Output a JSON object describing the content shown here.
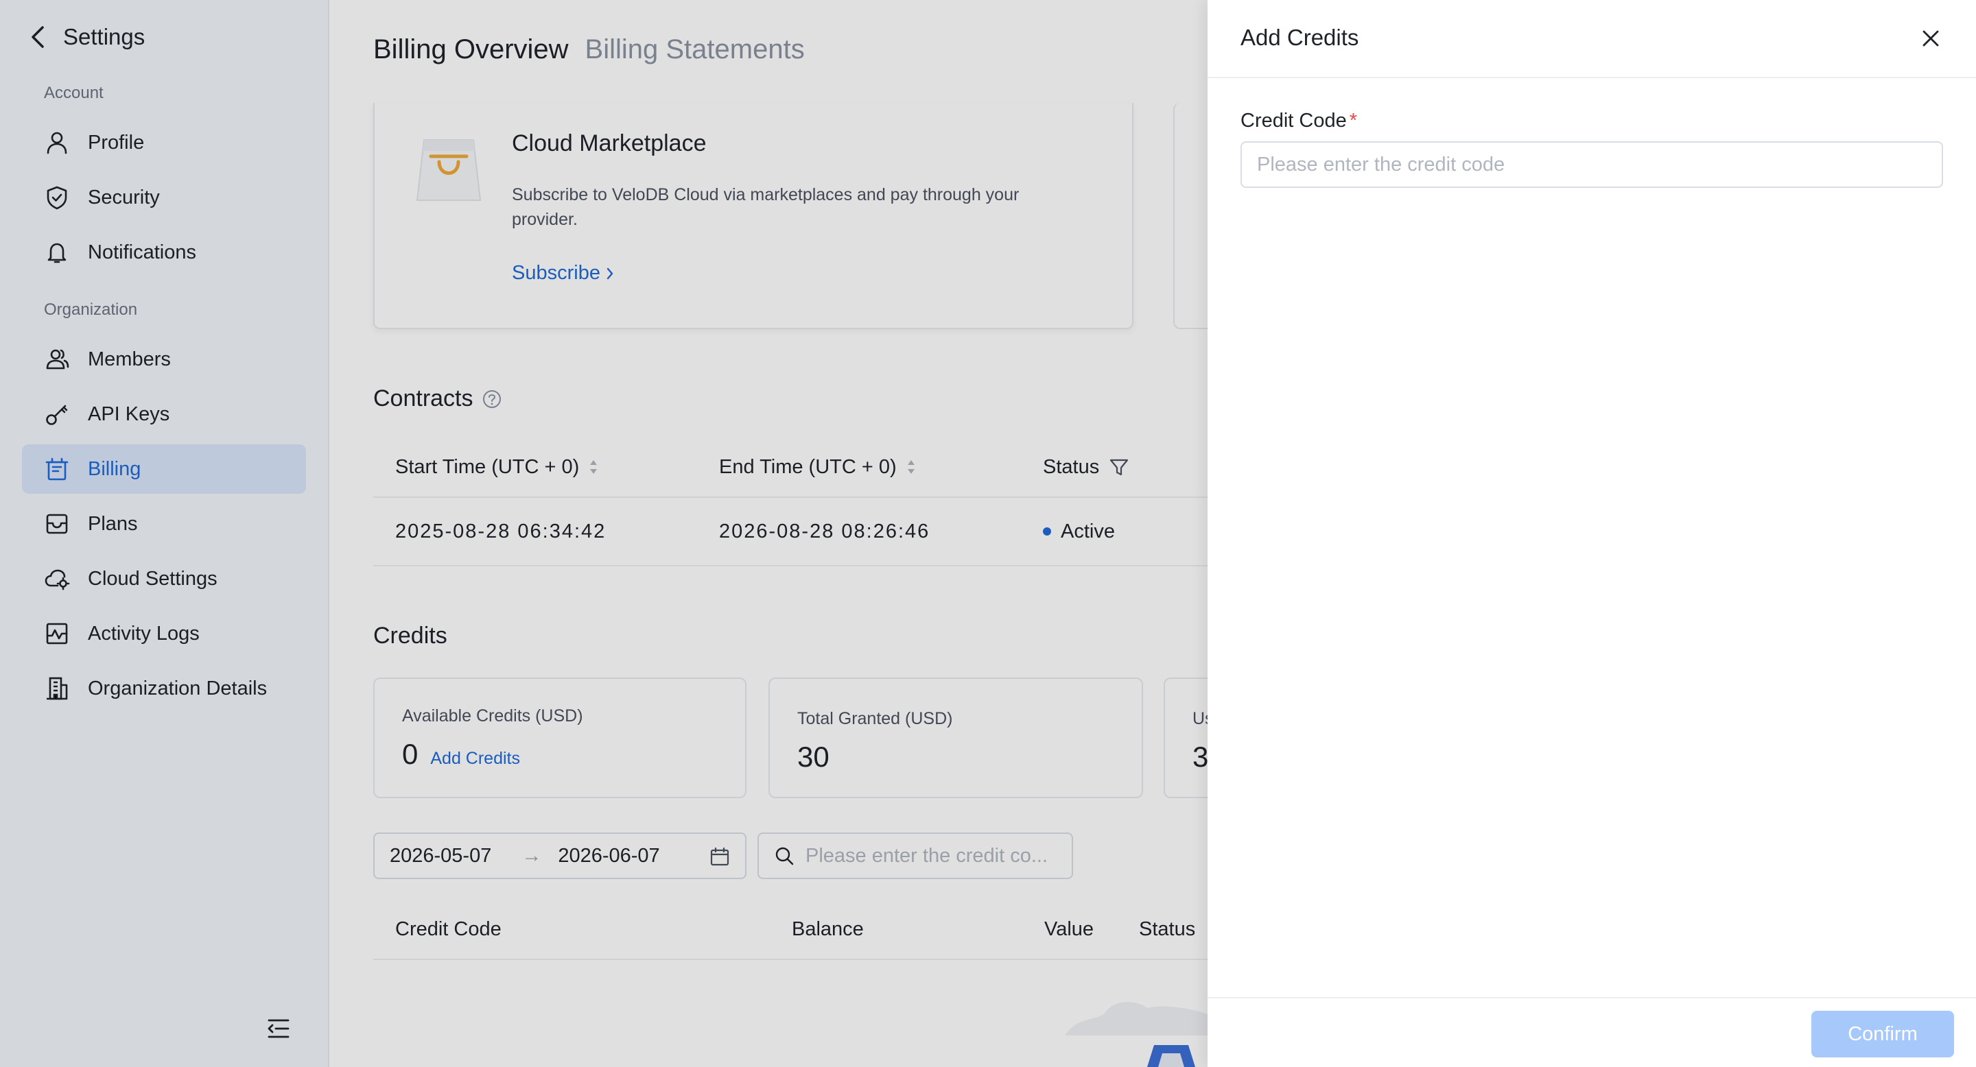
{
  "sidebar": {
    "title": "Settings",
    "sections": [
      {
        "label": "Account"
      },
      {
        "label": "Organization"
      }
    ],
    "items": [
      {
        "label": "Profile",
        "icon": "user-icon"
      },
      {
        "label": "Security",
        "icon": "shield-icon"
      },
      {
        "label": "Notifications",
        "icon": "bell-icon"
      },
      {
        "label": "Members",
        "icon": "users-icon"
      },
      {
        "label": "API Keys",
        "icon": "key-icon"
      },
      {
        "label": "Billing",
        "icon": "billing-icon",
        "active": true
      },
      {
        "label": "Plans",
        "icon": "plans-icon"
      },
      {
        "label": "Cloud Settings",
        "icon": "cloud-settings-icon"
      },
      {
        "label": "Activity Logs",
        "icon": "activity-icon"
      },
      {
        "label": "Organization Details",
        "icon": "building-icon"
      }
    ]
  },
  "main": {
    "tabs": [
      {
        "label": "Billing Overview",
        "active": true
      },
      {
        "label": "Billing Statements",
        "active": false
      }
    ],
    "marketplace": {
      "title": "Cloud Marketplace",
      "description": "Subscribe to VeloDB Cloud via marketplaces and pay through your provider.",
      "link": "Subscribe"
    },
    "contracts": {
      "title": "Contracts",
      "columns": [
        "Start Time (UTC + 0)",
        "End Time (UTC + 0)",
        "Status"
      ],
      "rows": [
        {
          "start": "2025-08-28 06:34:42",
          "end": "2026-08-28 08:26:46",
          "status": "Active"
        }
      ]
    },
    "credits": {
      "title": "Credits",
      "stats": [
        {
          "label": "Available Credits (USD)",
          "value": "0",
          "link": "Add Credits"
        },
        {
          "label": "Total Granted (USD)",
          "value": "30"
        },
        {
          "label": "Us",
          "value": "3"
        }
      ],
      "date_start": "2026-05-07",
      "date_end": "2026-06-07",
      "search_placeholder": "Please enter the credit co...",
      "columns": [
        "Credit Code",
        "Balance",
        "Value",
        "Status"
      ]
    }
  },
  "drawer": {
    "title": "Add Credits",
    "field_label": "Credit Code",
    "required_mark": "*",
    "placeholder": "Please enter the credit code",
    "confirm": "Confirm"
  },
  "colors": {
    "accent": "#1f6ad9",
    "active_bg": "#d9e6fb",
    "confirm_disabled": "#a6c8fb",
    "required": "#e5484d"
  }
}
